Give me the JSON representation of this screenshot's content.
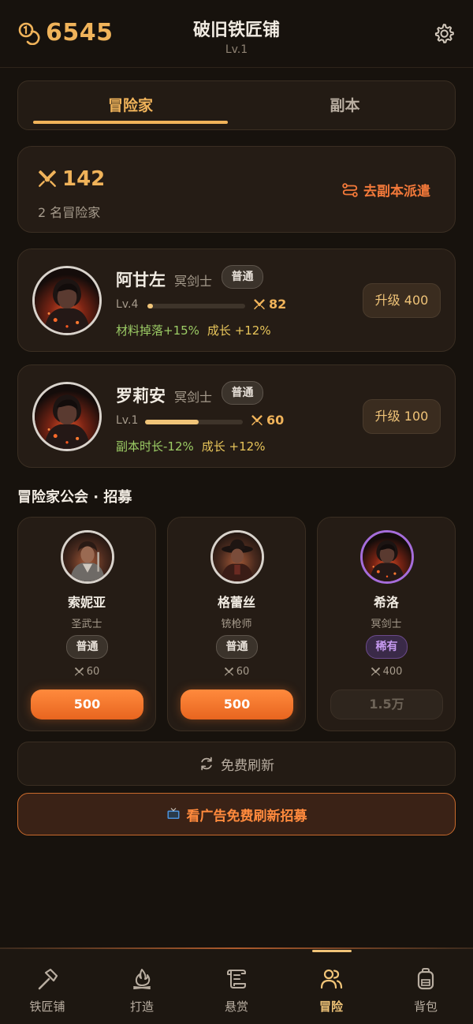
{
  "header": {
    "coins": "6545",
    "title": "破旧铁匠铺",
    "level": "Lv.1",
    "coin_icon": "coins-icon",
    "settings_icon": "gear-icon"
  },
  "tabs": [
    {
      "label": "冒险家",
      "active": true
    },
    {
      "label": "副本",
      "active": false
    }
  ],
  "summary": {
    "total_power": "142",
    "adventurer_count": "2 名冒险家",
    "dispatch_label": "去副本派遣"
  },
  "adventurers": [
    {
      "name": "阿甘左",
      "class": "冥剑士",
      "rarity": "普通",
      "level": "Lv.4",
      "xp_progress": 0.06,
      "power": "82",
      "bonus1": "材料掉落+15%",
      "bonus2": "成长 +12%",
      "upgrade_label": "升级 400"
    },
    {
      "name": "罗莉安",
      "class": "冥剑士",
      "rarity": "普通",
      "level": "Lv.1",
      "xp_progress": 0.55,
      "power": "60",
      "bonus1": "副本时长-12%",
      "bonus2": "成长 +12%",
      "upgrade_label": "升级 100"
    }
  ],
  "guild": {
    "heading": "冒险家公会 · 招募",
    "recruits": [
      {
        "name": "索妮亚",
        "class": "圣武士",
        "rarity": "普通",
        "power": "60",
        "price": "500",
        "affordable": true
      },
      {
        "name": "格蕾丝",
        "class": "铳枪师",
        "rarity": "普通",
        "power": "60",
        "price": "500",
        "affordable": true
      },
      {
        "name": "希洛",
        "class": "冥剑士",
        "rarity": "稀有",
        "power": "400",
        "price": "1.5万",
        "affordable": false
      }
    ],
    "free_refresh_label": "免费刷新",
    "ad_refresh_label": "看广告免费刷新招募"
  },
  "nav": [
    {
      "label": "铁匠铺",
      "icon": "hammer-icon",
      "active": false
    },
    {
      "label": "打造",
      "icon": "flame-icon",
      "active": false
    },
    {
      "label": "悬赏",
      "icon": "scroll-icon",
      "active": false
    },
    {
      "label": "冒险",
      "icon": "users-icon",
      "active": true
    },
    {
      "label": "背包",
      "icon": "backpack-icon",
      "active": false
    }
  ],
  "colors": {
    "accent": "#f0b35a",
    "orange": "#ff8a3d",
    "rare": "#a66ddb",
    "bonus_green": "#9ccc65",
    "bonus_yellow": "#e8c55a",
    "background": "#17120d"
  }
}
